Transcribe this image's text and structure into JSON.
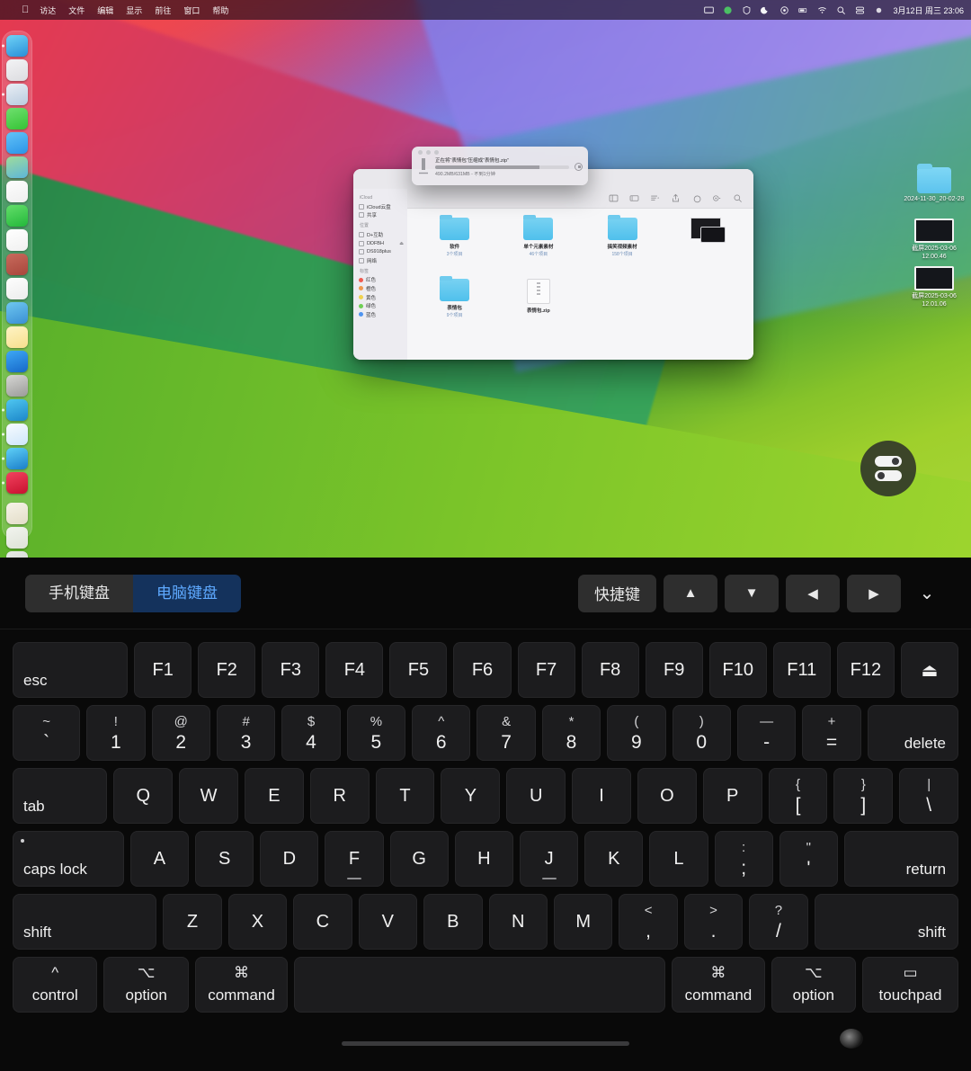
{
  "menubar": {
    "apple_icon": "apple-icon",
    "items": [
      "访达",
      "文件",
      "编辑",
      "显示",
      "前往",
      "窗口",
      "帮助"
    ],
    "tray_icons": [
      "display-icon",
      "phone-icon",
      "shield-icon",
      "moon-icon",
      "record-icon",
      "battery-icon",
      "wifi-icon",
      "search-icon",
      "controlcenter-icon",
      "siri-icon"
    ],
    "clock": "3月12日 周三 23:06"
  },
  "dock": {
    "items": [
      {
        "name": "finder",
        "color1": "#6fd3f7",
        "color2": "#2a8fd8",
        "running": true
      },
      {
        "name": "launchpad",
        "color1": "#f3f3f5",
        "color2": "#dcdce0",
        "running": false
      },
      {
        "name": "safari",
        "color1": "#e9eef5",
        "color2": "#b9ccdf",
        "running": true
      },
      {
        "name": "wechat",
        "color1": "#6fe06f",
        "color2": "#35c335",
        "running": false
      },
      {
        "name": "mail",
        "color1": "#62c3f7",
        "color2": "#2b94e8",
        "running": false
      },
      {
        "name": "maps",
        "color1": "#9fdc9b",
        "color2": "#5db6d9",
        "running": false
      },
      {
        "name": "photos",
        "color1": "#fdfdfd",
        "color2": "#efefef",
        "running": false
      },
      {
        "name": "facetime",
        "color1": "#63de6a",
        "color2": "#23b83a",
        "running": false
      },
      {
        "name": "calendar",
        "color1": "#ffffff",
        "color2": "#f0f0f0",
        "running": false
      },
      {
        "name": "reminders-old",
        "color1": "#c86a5c",
        "color2": "#a8473c",
        "running": false
      },
      {
        "name": "notes-list",
        "color1": "#fefefe",
        "color2": "#ececec",
        "running": false
      },
      {
        "name": "music-studio",
        "color1": "#6ec7f0",
        "color2": "#3a8fd4",
        "running": false
      },
      {
        "name": "notes",
        "color1": "#fff3c4",
        "color2": "#f6df8d",
        "running": false
      },
      {
        "name": "appstore",
        "color1": "#3ea8f5",
        "color2": "#1668c9",
        "running": false
      },
      {
        "name": "compass-app",
        "color1": "#d6d6d4",
        "color2": "#9b9b99",
        "running": false
      },
      {
        "name": "preview-search",
        "color1": "#4fc6f0",
        "color2": "#1c87c9",
        "running": true
      },
      {
        "name": "downloads-arrow",
        "color1": "#f7fbff",
        "color2": "#cfe6fa",
        "running": true
      },
      {
        "name": "edge-browser",
        "color1": "#5fd0f7",
        "color2": "#1a7ec9",
        "running": true
      },
      {
        "name": "keynote-red",
        "color1": "#f2425f",
        "color2": "#c8112f",
        "running": true
      },
      {
        "name": "document-1",
        "color1": "#f6f3e8",
        "color2": "#e3ddc8",
        "running": false
      },
      {
        "name": "document-2",
        "color1": "#f2f4ef",
        "color2": "#dde2d6",
        "running": false
      },
      {
        "name": "trash",
        "color1": "#e9ebe8",
        "color2": "#c7ccc6",
        "running": false
      }
    ]
  },
  "desktop": {
    "items": [
      {
        "type": "folder",
        "label": "2024-11-30_20-02-28"
      },
      {
        "type": "screenshot",
        "label": "截屏2025-03-06 12.00.46"
      },
      {
        "type": "screenshot",
        "label": "截屏2025-03-06 12.01.06"
      }
    ]
  },
  "progress_sheet": {
    "title": "正在将“表情包”压缩成“表情包.zip”",
    "detail": "490.2MB/631MB - 不到1分钟",
    "percent": 78,
    "stop_icon": "stop-icon"
  },
  "finder": {
    "sidebar": {
      "sections": [
        {
          "title": "iCloud",
          "rows": [
            {
              "icon": "icloud-icon",
              "label": "iCloud云盘"
            },
            {
              "icon": "shared-icon",
              "label": "共享"
            }
          ]
        },
        {
          "title": "位置",
          "rows": [
            {
              "icon": "disk-icon",
              "label": "D+互助"
            },
            {
              "icon": "server-icon",
              "label": "DDFBH",
              "eject": true
            },
            {
              "icon": "server-icon",
              "label": "DS918plus"
            },
            {
              "icon": "network-icon",
              "label": "网络"
            }
          ]
        },
        {
          "title": "标签",
          "rows": [
            {
              "icon": "tag-icon",
              "label": "红色",
              "color": "#f05a4f"
            },
            {
              "icon": "tag-icon",
              "label": "橙色",
              "color": "#f0984f"
            },
            {
              "icon": "tag-icon",
              "label": "黄色",
              "color": "#f0d24f"
            },
            {
              "icon": "tag-icon",
              "label": "绿色",
              "color": "#6fce55"
            },
            {
              "icon": "tag-icon",
              "label": "蓝色",
              "color": "#4f94f0"
            }
          ]
        }
      ]
    },
    "toolbar_icons": [
      "sidebar-toggle-icon",
      "gallery-view-icon",
      "group-by-icon",
      "share-icon",
      "tag-icon",
      "action-menu-icon",
      "search-icon"
    ],
    "files": [
      {
        "type": "folder",
        "name": "软件",
        "sub": "3个项目"
      },
      {
        "type": "folder",
        "name": "单个元素素材",
        "sub": "46个项目"
      },
      {
        "type": "folder",
        "name": "搞笑视频素材",
        "sub": "158个项目"
      },
      {
        "type": "image",
        "name": "",
        "sub": ""
      },
      {
        "type": "folder",
        "name": "表情包",
        "sub": "9个项目"
      },
      {
        "type": "zip",
        "name": "表情包.zip",
        "sub": ""
      }
    ]
  },
  "assistive_touch": {
    "name": "assistive-touch-button",
    "icon": "toggles-icon"
  },
  "kb_toolbar": {
    "phone_keyboard": "手机键盘",
    "computer_keyboard": "电脑键盘",
    "active": "computer_keyboard",
    "shortcuts": "快捷键",
    "arrow_up": "▲",
    "arrow_down": "▼",
    "arrow_left": "◀",
    "arrow_right": "▶",
    "collapse": "⌄"
  },
  "keyboard": {
    "rows": [
      {
        "name": "function-row",
        "keys": [
          {
            "id": "esc",
            "label": "esc",
            "style": "corner-bl",
            "flex": 2.0
          },
          {
            "id": "f1",
            "label": "F1",
            "flex": 1
          },
          {
            "id": "f2",
            "label": "F2",
            "flex": 1
          },
          {
            "id": "f3",
            "label": "F3",
            "flex": 1
          },
          {
            "id": "f4",
            "label": "F4",
            "flex": 1
          },
          {
            "id": "f5",
            "label": "F5",
            "flex": 1
          },
          {
            "id": "f6",
            "label": "F6",
            "flex": 1
          },
          {
            "id": "f7",
            "label": "F7",
            "flex": 1
          },
          {
            "id": "f8",
            "label": "F8",
            "flex": 1
          },
          {
            "id": "f9",
            "label": "F9",
            "flex": 1
          },
          {
            "id": "f10",
            "label": "F10",
            "flex": 1
          },
          {
            "id": "f11",
            "label": "F11",
            "flex": 1
          },
          {
            "id": "f12",
            "label": "F12",
            "flex": 1
          },
          {
            "id": "eject",
            "label": "⏏",
            "flex": 1
          }
        ]
      },
      {
        "name": "number-row",
        "keys": [
          {
            "id": "backtick",
            "upper": "~",
            "lower": "`",
            "flex": 1.15
          },
          {
            "id": "1",
            "upper": "!",
            "lower": "1",
            "flex": 1
          },
          {
            "id": "2",
            "upper": "@",
            "lower": "2",
            "flex": 1
          },
          {
            "id": "3",
            "upper": "#",
            "lower": "3",
            "flex": 1
          },
          {
            "id": "4",
            "upper": "$",
            "lower": "4",
            "flex": 1
          },
          {
            "id": "5",
            "upper": "%",
            "lower": "5",
            "flex": 1
          },
          {
            "id": "6",
            "upper": "^",
            "lower": "6",
            "flex": 1
          },
          {
            "id": "7",
            "upper": "&",
            "lower": "7",
            "flex": 1
          },
          {
            "id": "8",
            "upper": "*",
            "lower": "8",
            "flex": 1
          },
          {
            "id": "9",
            "upper": "(",
            "lower": "9",
            "flex": 1
          },
          {
            "id": "0",
            "upper": ")",
            "lower": "0",
            "flex": 1
          },
          {
            "id": "minus",
            "upper": "—",
            "lower": "-",
            "flex": 1
          },
          {
            "id": "equal",
            "upper": "+",
            "lower": "=",
            "flex": 1
          },
          {
            "id": "delete",
            "label": "delete",
            "style": "corner-br",
            "flex": 1.55
          }
        ]
      },
      {
        "name": "qwerty-row",
        "keys": [
          {
            "id": "tab",
            "label": "tab",
            "style": "corner-bl",
            "flex": 1.6
          },
          {
            "id": "q",
            "label": "Q",
            "flex": 1
          },
          {
            "id": "w",
            "label": "W",
            "flex": 1
          },
          {
            "id": "e",
            "label": "E",
            "flex": 1
          },
          {
            "id": "r",
            "label": "R",
            "flex": 1
          },
          {
            "id": "t",
            "label": "T",
            "flex": 1
          },
          {
            "id": "y",
            "label": "Y",
            "flex": 1
          },
          {
            "id": "u",
            "label": "U",
            "flex": 1
          },
          {
            "id": "i",
            "label": "I",
            "flex": 1
          },
          {
            "id": "o",
            "label": "O",
            "flex": 1
          },
          {
            "id": "p",
            "label": "P",
            "flex": 1
          },
          {
            "id": "bracket-left",
            "upper": "{",
            "lower": "[",
            "flex": 1
          },
          {
            "id": "bracket-right",
            "upper": "}",
            "lower": "]",
            "flex": 1
          },
          {
            "id": "backslash",
            "upper": "|",
            "lower": "\\",
            "flex": 1
          }
        ]
      },
      {
        "name": "home-row",
        "keys": [
          {
            "id": "capslock",
            "label": "caps lock",
            "style": "corner-bl",
            "dot": true,
            "flex": 1.9
          },
          {
            "id": "a",
            "label": "A",
            "flex": 1
          },
          {
            "id": "s",
            "label": "S",
            "flex": 1
          },
          {
            "id": "d",
            "label": "D",
            "flex": 1
          },
          {
            "id": "f",
            "label": "F",
            "homebar": true,
            "flex": 1
          },
          {
            "id": "g",
            "label": "G",
            "flex": 1
          },
          {
            "id": "h",
            "label": "H",
            "flex": 1
          },
          {
            "id": "j",
            "label": "J",
            "homebar": true,
            "flex": 1
          },
          {
            "id": "k",
            "label": "K",
            "flex": 1
          },
          {
            "id": "l",
            "label": "L",
            "flex": 1
          },
          {
            "id": "semicolon",
            "upper": ":",
            "lower": ";",
            "flex": 1
          },
          {
            "id": "quote",
            "upper": "\"",
            "lower": "'",
            "flex": 1
          },
          {
            "id": "return",
            "label": "return",
            "style": "corner-br",
            "flex": 1.95
          }
        ]
      },
      {
        "name": "shift-row",
        "keys": [
          {
            "id": "shift-left",
            "label": "shift",
            "style": "corner-bl",
            "flex": 2.45
          },
          {
            "id": "z",
            "label": "Z",
            "flex": 1
          },
          {
            "id": "x",
            "label": "X",
            "flex": 1
          },
          {
            "id": "c",
            "label": "C",
            "flex": 1
          },
          {
            "id": "v",
            "label": "V",
            "flex": 1
          },
          {
            "id": "b",
            "label": "B",
            "flex": 1
          },
          {
            "id": "n",
            "label": "N",
            "flex": 1
          },
          {
            "id": "m",
            "label": "M",
            "flex": 1
          },
          {
            "id": "comma",
            "upper": "<",
            "lower": ",",
            "flex": 1
          },
          {
            "id": "period",
            "upper": ">",
            "lower": ".",
            "flex": 1
          },
          {
            "id": "slash",
            "upper": "?",
            "lower": "/",
            "flex": 1
          },
          {
            "id": "shift-right",
            "label": "shift",
            "style": "corner-br",
            "flex": 2.45
          }
        ]
      },
      {
        "name": "modifier-row",
        "keys": [
          {
            "id": "control",
            "sym": "^",
            "name": "control",
            "flex": 1.28
          },
          {
            "id": "option-left",
            "sym": "⌥",
            "name": "option",
            "flex": 1.28
          },
          {
            "id": "command-left",
            "sym": "⌘",
            "name": "command",
            "flex": 1.4
          },
          {
            "id": "space",
            "label": "",
            "flex": 5.6
          },
          {
            "id": "command-right",
            "sym": "⌘",
            "name": "command",
            "flex": 1.4
          },
          {
            "id": "option-right",
            "sym": "⌥",
            "name": "option",
            "flex": 1.28
          },
          {
            "id": "touchpad",
            "sym": "▭",
            "name": "touchpad",
            "flex": 1.45
          }
        ]
      }
    ]
  }
}
